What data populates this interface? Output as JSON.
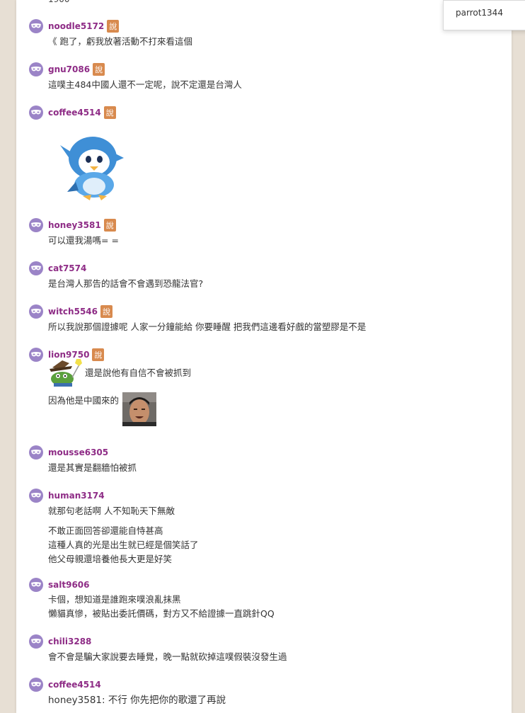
{
  "top_cut_text": "1900",
  "popup_user": "parrot1344",
  "badge_label": "說",
  "comments": [
    {
      "user": "noodle5172",
      "lines": [
        "《 跑了，虧我放著活動不打來看這個"
      ]
    },
    {
      "user": "gnu7086",
      "lines": [
        "這噗主484中國人還不一定呢，說不定還是台灣人"
      ]
    },
    {
      "user": "coffee4514",
      "lines": []
    },
    {
      "user": "honey3581",
      "lines": [
        "可以還我湯嗎= ="
      ]
    },
    {
      "user": "cat7574",
      "lines": [
        "是台灣人那告的話會不會遇到恐龍法官?"
      ]
    },
    {
      "user": "witch5546",
      "lines": [
        "所以我說那個證據呢 人家一分鐘能給 你要睡醒 把我們這邊看好戲的當塑膠是不是"
      ]
    },
    {
      "user": "lion9750",
      "lines": [
        "還是說他有自信不會被抓到",
        "因為他是中國來的"
      ]
    },
    {
      "user": "mousse6305",
      "lines": [
        "還是其實是翻牆怕被抓"
      ]
    },
    {
      "user": "human3174",
      "lines": [
        "就那句老話啊 人不知恥天下無敵",
        "不敢正面回答卻還能自恃甚高",
        "這種人真的光是出生就已經是個笑話了",
        "他父母親還培養他長大更是好笑"
      ]
    },
    {
      "user": "salt9606",
      "lines": [
        "卡個，想知道是誰跑來噗浪亂抹黑",
        "懶貓真慘，被貼出委託價碼，對方又不給證據一直跳針QQ"
      ]
    },
    {
      "user": "chili3288",
      "lines": [
        "會不會是騙大家說要去睡覺，晚一點就砍掉這噗假裝沒發生過"
      ]
    },
    {
      "user": "coffee4514",
      "lines": [
        "honey3581: 不行 你先把你的歌還了再說"
      ]
    }
  ]
}
